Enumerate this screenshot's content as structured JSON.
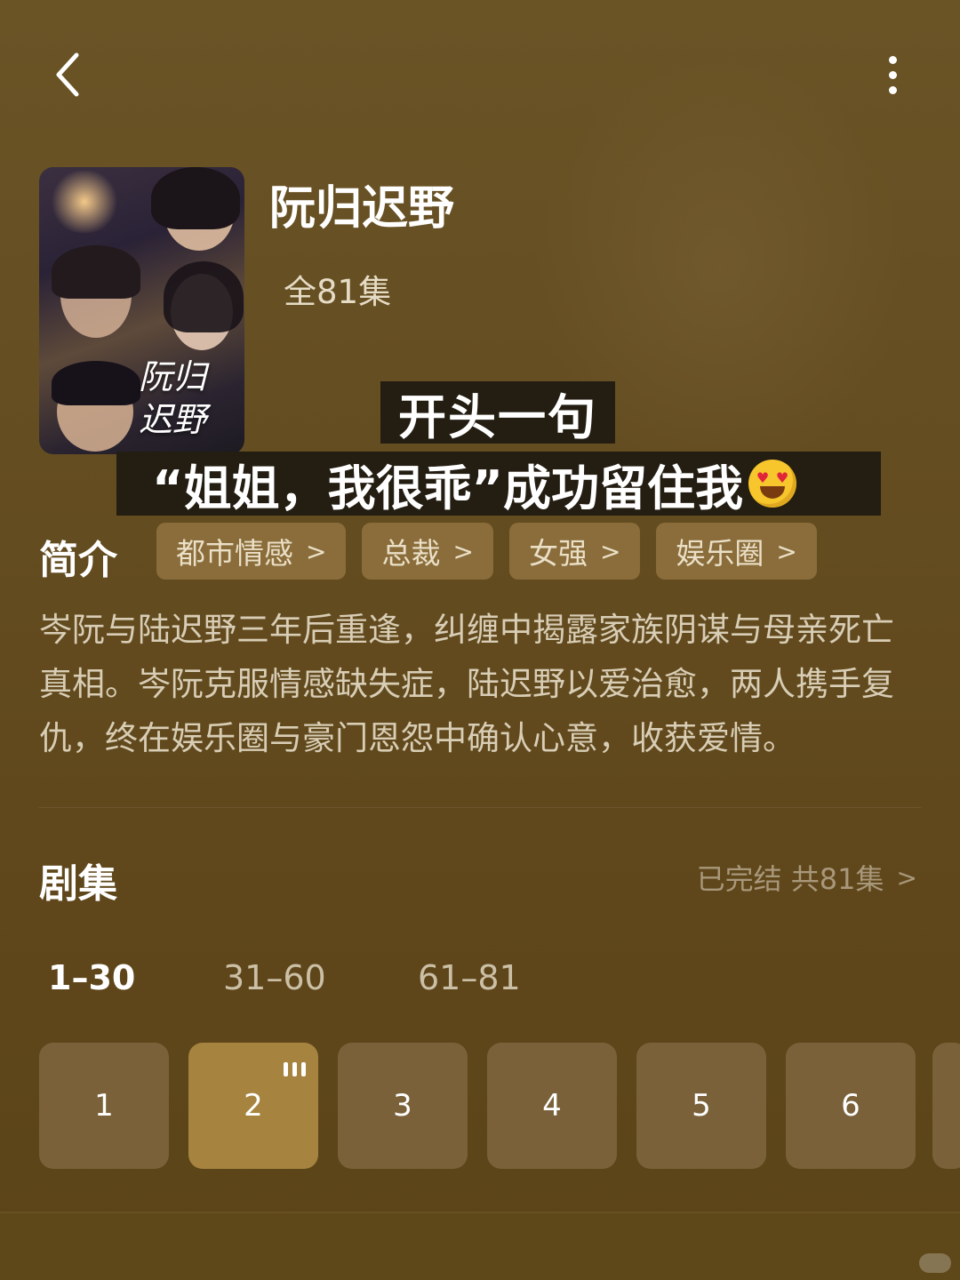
{
  "header": {
    "back_icon": "chevron-left-icon",
    "more_icon": "more-vertical-icon"
  },
  "drama": {
    "title": "阮归迟野",
    "episode_total": "全81集",
    "poster_title": "阮归迟野"
  },
  "caption": {
    "line1": "开头一句",
    "line2": "“姐姐，我很乖”成功留住我",
    "emoji": "heart-eyes-emoji"
  },
  "intro": {
    "label": "简介",
    "tags": [
      "都市情感",
      "总裁",
      "女强",
      "娱乐圈"
    ],
    "description": "岑阮与陆迟野三年后重逢，纠缠中揭露家族阴谋与母亲死亡真相。岑阮克服情感缺失症，陆迟野以爱治愈，两人携手复仇，终在娱乐圈与豪门恩怨中确认心意，收获爱情。"
  },
  "episodes": {
    "label": "剧集",
    "status": "已完结 共81集",
    "ranges": [
      "1–30",
      "31–60",
      "61–81"
    ],
    "active_range": "1–30",
    "items": [
      "1",
      "2",
      "3",
      "4",
      "5",
      "6"
    ],
    "playing": "2"
  },
  "colors": {
    "accent": "#a6843f",
    "tag_bg": "#8a6d3a",
    "tile_bg": "#7a6139",
    "background": "#644d21"
  }
}
